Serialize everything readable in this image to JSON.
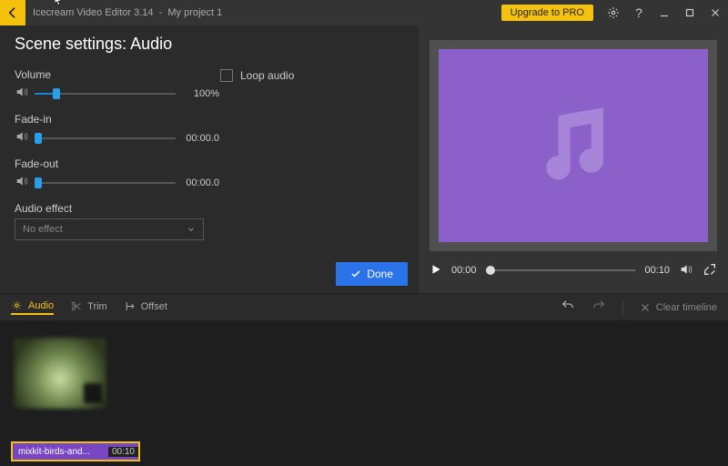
{
  "titlebar": {
    "app_name": "Icecream Video Editor 3.14",
    "project": "My project 1",
    "upgrade": "Upgrade to PRO"
  },
  "page": {
    "title": "Scene settings: Audio"
  },
  "volume": {
    "label": "Volume",
    "value": "100%",
    "percent": 13
  },
  "fadein": {
    "label": "Fade-in",
    "value": "00:00.0",
    "percent": 0
  },
  "fadeout": {
    "label": "Fade-out",
    "value": "00:00.0",
    "percent": 0
  },
  "loop": {
    "label": "Loop audio",
    "checked": false
  },
  "effect": {
    "label": "Audio effect",
    "selected": "No effect"
  },
  "done": {
    "label": "Done"
  },
  "player": {
    "current": "00:00",
    "duration": "00:10"
  },
  "tools": {
    "audio": "Audio",
    "trim": "Trim",
    "offset": "Offset",
    "clear": "Clear timeline"
  },
  "clip": {
    "name": "mixkit-birds-and...",
    "duration": "00:10"
  }
}
